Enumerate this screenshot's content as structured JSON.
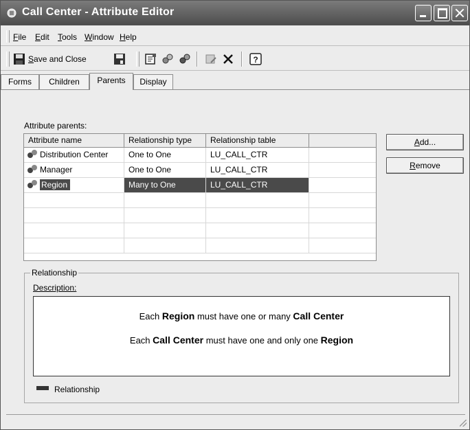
{
  "window": {
    "title": "Call Center - Attribute Editor"
  },
  "menu": [
    "File",
    "Edit",
    "Tools",
    "Window",
    "Help"
  ],
  "toolbar": {
    "save_label": "Save and Close"
  },
  "tabs": [
    "Forms",
    "Children",
    "Parents",
    "Display"
  ],
  "active_tab": "Parents",
  "parents_section": {
    "label": "Attribute parents:"
  },
  "grid": {
    "columns": [
      "Attribute name",
      "Relationship type",
      "Relationship table",
      ""
    ],
    "rows": [
      {
        "name": "Distribution Center",
        "type": "One to One",
        "table": "LU_CALL_CTR"
      },
      {
        "name": "Manager",
        "type": "One to One",
        "table": "LU_CALL_CTR"
      },
      {
        "name": "Region",
        "type": "Many to One",
        "table": "LU_CALL_CTR"
      }
    ],
    "selected_row": 2
  },
  "buttons": {
    "add": "Add...",
    "remove": "Remove"
  },
  "relationship": {
    "legend": "Relationship",
    "description_label": "Description:",
    "line1": [
      "Each ",
      "Region",
      " must have one or many ",
      "Call Center"
    ],
    "line2": [
      "Each ",
      "Call Center",
      " must have one and only one ",
      "Region"
    ],
    "key_label": "Relationship"
  },
  "colors": {
    "titlebar": "#5a5a5a",
    "selection": "#4a4a4a",
    "window_bg": "#ececec"
  }
}
